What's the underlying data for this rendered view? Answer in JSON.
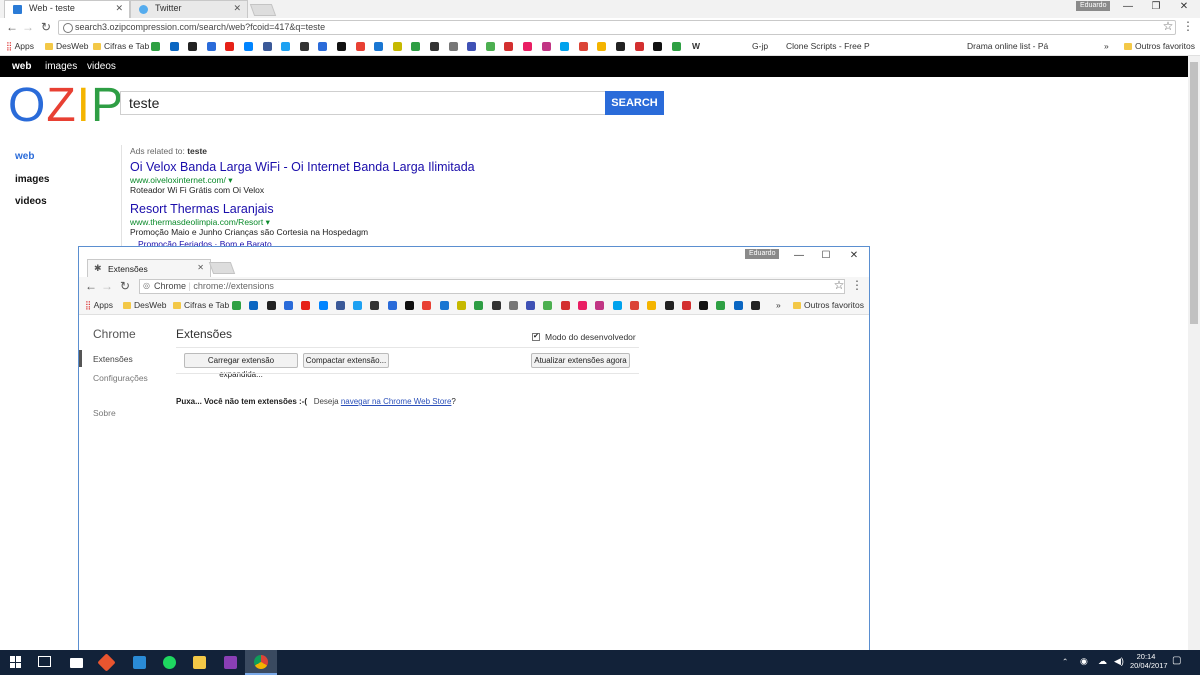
{
  "browser": {
    "tabs": [
      {
        "label": "Web - teste",
        "favicon_color": "#2b7bd6"
      },
      {
        "label": "Twitter",
        "favicon_color": "#55acee"
      }
    ],
    "profile_name": "Eduardo",
    "window_controls": {
      "minimize": "—",
      "restore": "❐",
      "close": "✕"
    },
    "url": "search3.ozipcompression.com/search/web?fcoid=417&q=teste",
    "star": "☆",
    "menu": "⋮",
    "bookmarks": {
      "apps": "Apps",
      "desweb": "DesWeb",
      "cifras": "Cifras e Tab",
      "wiki": "W",
      "gjp": "G-jp",
      "clone": "Clone Scripts - Free P",
      "drama": "Drama online list - Pá",
      "more": "»",
      "outros": "Outros favoritos"
    }
  },
  "page": {
    "topbar": {
      "web": "web",
      "images": "images",
      "videos": "videos"
    },
    "logo": {
      "o": "O",
      "z": "Z",
      "i": "I",
      "p": "P"
    },
    "search_value": "teste",
    "search_button": "SEARCH",
    "sidenav": {
      "web": "web",
      "images": "images",
      "videos": "videos"
    },
    "ads_label": "Ads related to:",
    "ads_query": "teste",
    "ads": [
      {
        "title": "Oi Velox Banda Larga WiFi - Oi Internet Banda Larga Ilimitada",
        "url": "www.oivelox​internet.com/",
        "desc": "Roteador Wi Fi Grátis com Oi Velox"
      },
      {
        "title": "Resort Thermas Laranjais",
        "url": "www.thermasdeolimpia.com/Resort",
        "desc": "Promoção Maio e Junho Crianças são Cortesia na Hospedagm"
      }
    ],
    "ad_sublinks": "Promoção Feriados · Bom e Barato",
    "url_arrow": "▾"
  },
  "ext_window": {
    "tab_label": "Extensões",
    "profile_name": "Eduardo",
    "chrome_chip": "Chrome",
    "url": "chrome://extensions",
    "bookmarks": {
      "apps": "Apps",
      "desweb": "DesWeb",
      "cifras": "Cifras e Tab",
      "more": "»",
      "outros": "Outros favoritos"
    },
    "sidebar": {
      "title": "Chrome",
      "extensoes": "Extensões",
      "config": "Configurações",
      "sobre": "Sobre"
    },
    "heading": "Extensões",
    "dev_mode": "Modo do desenvolvedor",
    "btn_load": "Carregar extensão expandida...",
    "btn_pack": "Compactar extensão...",
    "btn_update": "Atualizar extensões agora",
    "empty_bold": "Puxa... Você não tem extensões :-(",
    "empty_text": "Deseja",
    "store_link": "navegar na Chrome Web Store",
    "qmark": "?"
  },
  "taskbar": {
    "time": "20:14",
    "date": "20/04/2017"
  },
  "colors": {
    "logo_o": "#2a6bd9",
    "logo_z": "#e84033",
    "logo_i": "#f4b400",
    "logo_p": "#2e9e44",
    "search_button": "#2a6bd9",
    "ad_link": "#1a0dab",
    "ad_url": "#0a8a2a",
    "taskbar": "#122239"
  }
}
